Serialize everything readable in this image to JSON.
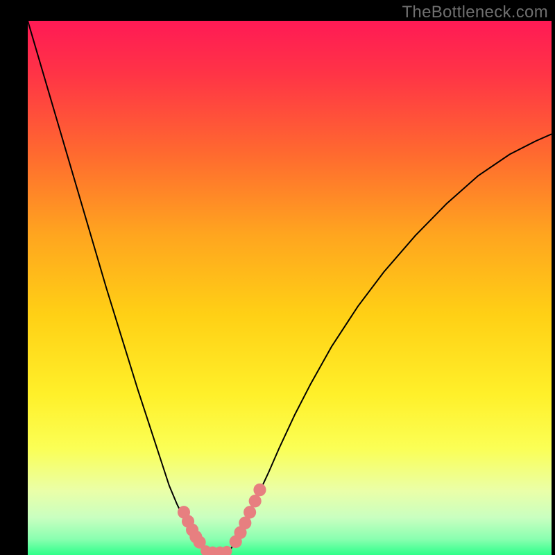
{
  "watermark": "TheBottleneck.com",
  "chart_data": {
    "type": "line",
    "title": "",
    "xlabel": "",
    "ylabel": "",
    "xlim": [
      0,
      100
    ],
    "ylim": [
      0,
      100
    ],
    "series": [
      {
        "name": "left-curve",
        "x": [
          0,
          3,
          6,
          9,
          12,
          15,
          18,
          21,
          24,
          25.5,
          27,
          28.5,
          30,
          31,
          32,
          33,
          34,
          35
        ],
        "y": [
          100,
          90,
          80,
          70,
          60,
          50,
          40.5,
          31,
          22,
          17.5,
          13,
          9.5,
          6.5,
          5,
          3.6,
          2.4,
          1.2,
          0
        ]
      },
      {
        "name": "right-curve",
        "x": [
          38,
          40,
          42,
          44,
          46,
          48,
          51,
          54,
          58,
          63,
          68,
          74,
          80,
          86,
          92,
          97,
          100
        ],
        "y": [
          0,
          3,
          7,
          11.3,
          15.5,
          20,
          26.3,
          32,
          39,
          46.5,
          53,
          59.8,
          65.8,
          71,
          75,
          77.5,
          78.8
        ]
      }
    ],
    "markers": [
      {
        "series": "left-curve",
        "x": 29.8,
        "y": 8.0,
        "r": 1.2
      },
      {
        "series": "left-curve",
        "x": 30.6,
        "y": 6.3,
        "r": 1.2
      },
      {
        "series": "left-curve",
        "x": 31.4,
        "y": 4.7,
        "r": 1.2
      },
      {
        "series": "left-curve",
        "x": 32.1,
        "y": 3.4,
        "r": 1.2
      },
      {
        "series": "left-curve",
        "x": 32.8,
        "y": 2.4,
        "r": 1.2
      },
      {
        "series": "mid",
        "x": 34.0,
        "y": 0.8,
        "r": 1.0
      },
      {
        "series": "mid",
        "x": 35.3,
        "y": 0.6,
        "r": 1.0
      },
      {
        "series": "mid",
        "x": 36.7,
        "y": 0.6,
        "r": 1.0
      },
      {
        "series": "mid",
        "x": 38.0,
        "y": 0.7,
        "r": 1.0
      },
      {
        "series": "right-curve",
        "x": 39.7,
        "y": 2.5,
        "r": 1.2
      },
      {
        "series": "right-curve",
        "x": 40.6,
        "y": 4.2,
        "r": 1.2
      },
      {
        "series": "right-curve",
        "x": 41.5,
        "y": 6.0,
        "r": 1.2
      },
      {
        "series": "right-curve",
        "x": 42.4,
        "y": 8.0,
        "r": 1.2
      },
      {
        "series": "right-curve",
        "x": 43.4,
        "y": 10.1,
        "r": 1.2
      },
      {
        "series": "right-curve",
        "x": 44.3,
        "y": 12.2,
        "r": 1.2
      }
    ],
    "gradient_stops": [
      {
        "offset": 0.0,
        "color": "#ff1a55"
      },
      {
        "offset": 0.1,
        "color": "#ff3446"
      },
      {
        "offset": 0.25,
        "color": "#ff6a2f"
      },
      {
        "offset": 0.4,
        "color": "#ffa51f"
      },
      {
        "offset": 0.55,
        "color": "#ffd015"
      },
      {
        "offset": 0.7,
        "color": "#fff02a"
      },
      {
        "offset": 0.8,
        "color": "#fbff55"
      },
      {
        "offset": 0.88,
        "color": "#eaffa8"
      },
      {
        "offset": 0.93,
        "color": "#c9ffc0"
      },
      {
        "offset": 0.97,
        "color": "#8affb0"
      },
      {
        "offset": 1.0,
        "color": "#2fff8a"
      }
    ],
    "marker_color": "#e77f80",
    "curve_color": "#000000",
    "curve_width": 2.0
  }
}
